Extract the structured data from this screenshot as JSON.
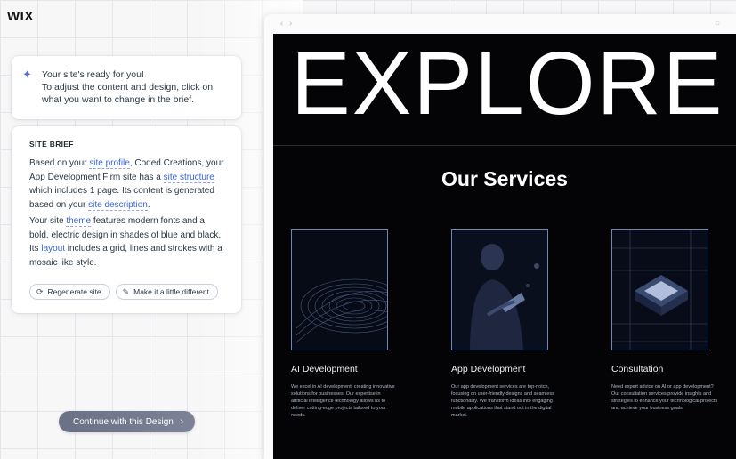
{
  "app": {
    "logo": "WIX"
  },
  "ready_card": {
    "icon": "sparkle-icon",
    "line1": "Your site's ready for you!",
    "line2": "To adjust the content and design, click on what you want to change in the brief."
  },
  "brief": {
    "title": "SITE BRIEF",
    "p1_a": "Based on your ",
    "p1_link1": "site profile",
    "p1_b": ", Coded Creations, your App Development Firm site has a ",
    "p1_link2": "site structure",
    "p1_c": " which includes 1 page. Its content is generated based on your ",
    "p1_link3": "site description",
    "p1_d": ".",
    "p2_a": "Your site ",
    "p2_link1": "theme",
    "p2_b": " features modern fonts and a bold, electric design in shades of blue and black. Its ",
    "p2_link2": "layout",
    "p2_c": " includes a grid, lines and strokes with a mosaic like style.",
    "regenerate_label": "Regenerate site",
    "different_label": "Make it a little different"
  },
  "continue_label": "Continue with this Design",
  "preview": {
    "hero": "EXPLORE",
    "services_title": "Our Services",
    "services": [
      {
        "title": "AI Development",
        "desc": "We excel in AI development, creating innovative solutions for businesses. Our expertise in artificial intelligence technology allows us to deliver cutting-edge projects tailored to your needs."
      },
      {
        "title": "App Development",
        "desc": "Our app development services are top-notch, focusing on user-friendly designs and seamless functionality. We transform ideas into engaging mobile applications that stand out in the digital market."
      },
      {
        "title": "Consultation",
        "desc": "Need expert advice on AI or app development? Our consultation services provide insights and strategies to enhance your technological projects and achieve your business goals."
      }
    ]
  },
  "colors": {
    "accent": "#3a66d4",
    "site_bg": "#040406",
    "button": "#6a7184"
  }
}
